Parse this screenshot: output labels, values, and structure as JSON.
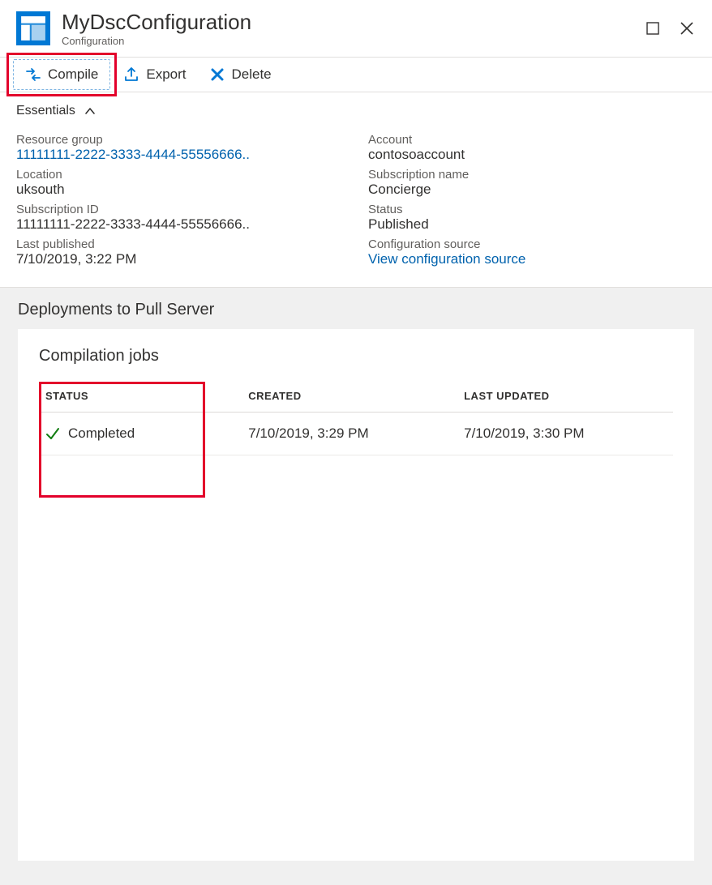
{
  "header": {
    "title": "MyDscConfiguration",
    "subtitle": "Configuration"
  },
  "toolbar": {
    "compile": "Compile",
    "export": "Export",
    "delete": "Delete"
  },
  "essentials": {
    "heading": "Essentials",
    "resource_group_label": "Resource group",
    "resource_group_value": "11111111-2222-3333-4444-55556666..",
    "location_label": "Location",
    "location_value": "uksouth",
    "subscription_id_label": "Subscription ID",
    "subscription_id_value": "11111111-2222-3333-4444-55556666..",
    "last_published_label": "Last published",
    "last_published_value": "7/10/2019, 3:22 PM",
    "account_label": "Account",
    "account_value": "contosoaccount",
    "subscription_name_label": "Subscription name",
    "subscription_name_value": "Concierge",
    "status_label": "Status",
    "status_value": "Published",
    "config_source_label": "Configuration source",
    "config_source_value": "View configuration source"
  },
  "deployments": {
    "heading": "Deployments to Pull Server",
    "jobs_heading": "Compilation jobs",
    "columns": {
      "status": "STATUS",
      "created": "CREATED",
      "last_updated": "LAST UPDATED"
    },
    "rows": [
      {
        "status": "Completed",
        "created": "7/10/2019, 3:29 PM",
        "last_updated": "7/10/2019, 3:30 PM"
      }
    ]
  }
}
